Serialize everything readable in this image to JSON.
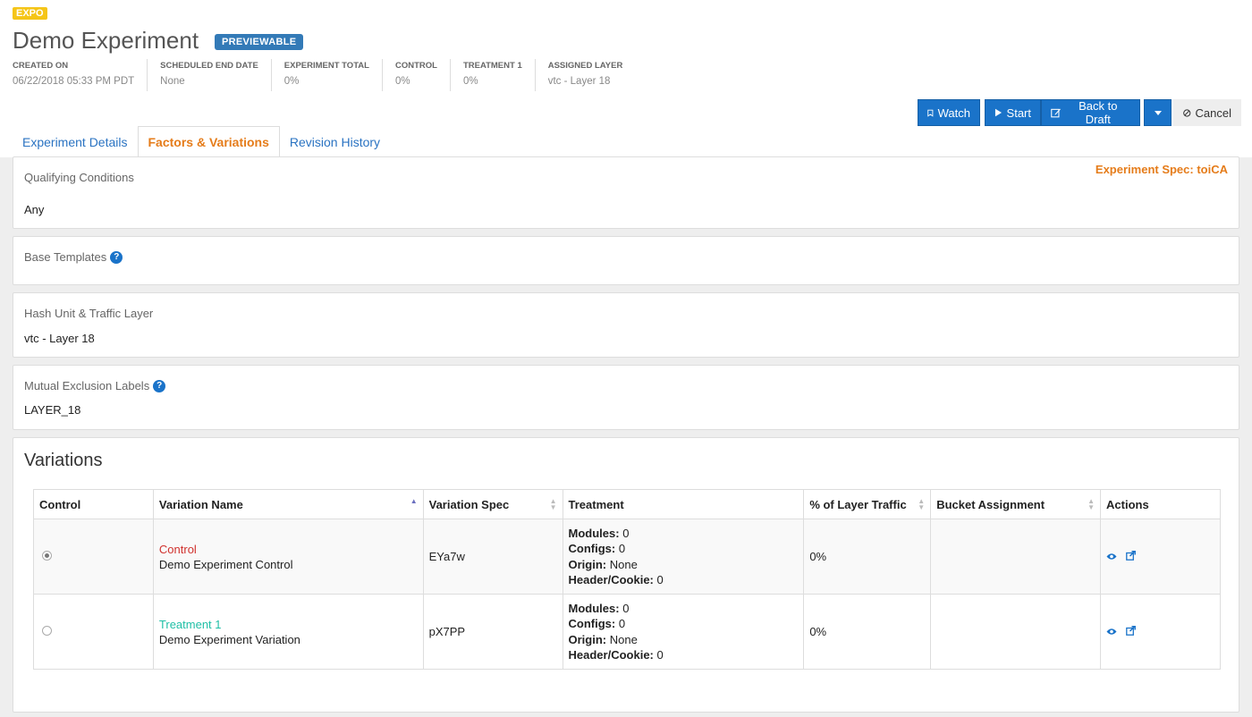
{
  "header": {
    "app_badge": "EXPO",
    "title": "Demo Experiment",
    "status": "PREVIEWABLE",
    "meta": [
      {
        "label": "CREATED ON",
        "value": "06/22/2018 05:33 PM PDT"
      },
      {
        "label": "SCHEDULED END DATE",
        "value": "None"
      },
      {
        "label": "EXPERIMENT TOTAL",
        "value": "0%"
      },
      {
        "label": "CONTROL",
        "value": "0%"
      },
      {
        "label": "TREATMENT 1",
        "value": "0%"
      },
      {
        "label": "ASSIGNED LAYER",
        "value": "vtc - Layer 18"
      }
    ]
  },
  "toolbar": {
    "watch_label": "Watch",
    "start_label": "Start",
    "back_to_draft_label": "Back to Draft",
    "cancel_label": "Cancel"
  },
  "tabs": [
    {
      "label": "Experiment Details"
    },
    {
      "label": "Factors & Variations"
    },
    {
      "label": "Revision History"
    }
  ],
  "qualifying": {
    "label": "Qualifying Conditions",
    "value": "Any",
    "spec": "Experiment Spec: toiCA"
  },
  "base_templates": {
    "label": "Base Templates"
  },
  "hash_unit": {
    "label": "Hash Unit & Traffic Layer",
    "value": "vtc - Layer 18"
  },
  "mutual_exclusion": {
    "label": "Mutual Exclusion Labels",
    "value": "LAYER_18"
  },
  "variations": {
    "title": "Variations",
    "columns": [
      "Control",
      "Variation Name",
      "Variation Spec",
      "Treatment",
      "% of Layer Traffic",
      "Bucket Assignment",
      "Actions"
    ],
    "treatment_labels": {
      "modules": "Modules:",
      "configs": "Configs:",
      "origin": "Origin:",
      "header": "Header/Cookie:"
    },
    "rows": [
      {
        "type": "Control",
        "name": "Demo Experiment Control",
        "spec": "EYa7w",
        "modules": "0",
        "configs": "0",
        "origin": "None",
        "header": "0",
        "traffic": "0%",
        "bucket": "",
        "selected": true
      },
      {
        "type": "Treatment 1",
        "name": "Demo Experiment Variation",
        "spec": "pX7PP",
        "modules": "0",
        "configs": "0",
        "origin": "None",
        "header": "0",
        "traffic": "0%",
        "bucket": "",
        "selected": false
      }
    ]
  },
  "colors": {
    "accent": "#1a73c9",
    "active_tab": "#e57c1a",
    "control": "#d0312d",
    "treatment": "#1fbfa6",
    "status_badge": "#337ab7",
    "app_badge": "#f5c518"
  }
}
